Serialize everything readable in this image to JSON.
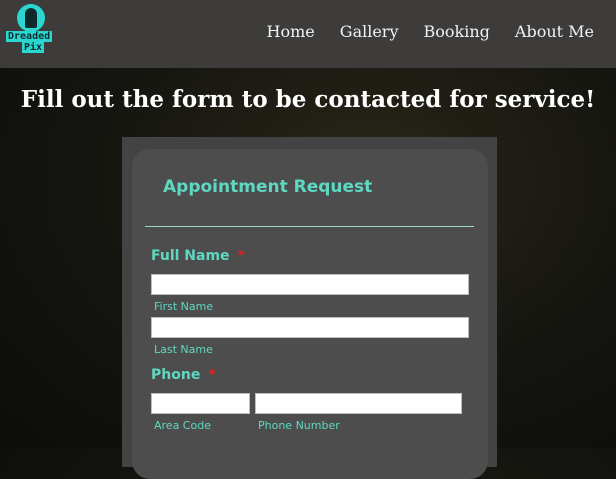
{
  "nav": {
    "logo_line1": "Dreaded",
    "logo_line2": "Pix",
    "links": [
      "Home",
      "Gallery",
      "Booking",
      "About Me"
    ]
  },
  "page": {
    "heading": "Fill out the form to be contacted for service!"
  },
  "form": {
    "title": "Appointment Request",
    "full_name": {
      "label": "Full Name",
      "required_mark": "*",
      "first_sublabel": "First Name",
      "last_sublabel": "Last Name",
      "first_value": "",
      "last_value": ""
    },
    "phone": {
      "label": "Phone",
      "required_mark": "*",
      "area_sublabel": "Area Code",
      "number_sublabel": "Phone Number",
      "area_value": "",
      "number_value": ""
    }
  },
  "colors": {
    "accent": "#5fd8c2",
    "required": "#e02020",
    "navbar": "#3d3c3b",
    "logo": "#2ad6cf"
  }
}
